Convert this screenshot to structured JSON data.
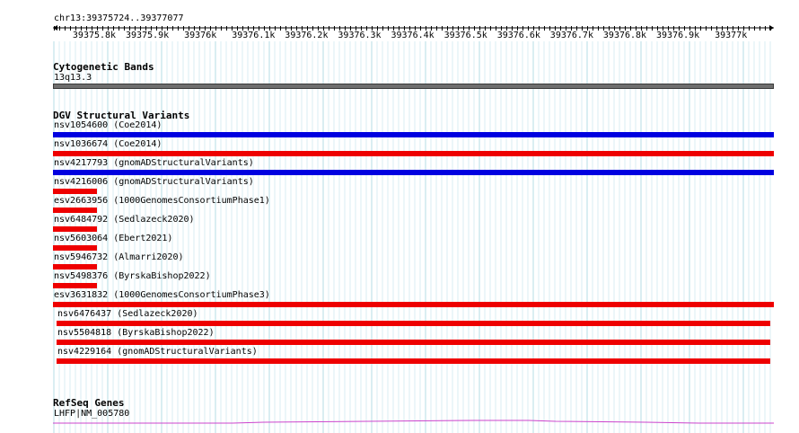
{
  "location": "chr13:39375724..39377077",
  "ruler_ticks": [
    "39375.8k",
    "39375.9k",
    "39376k",
    "39376.1k",
    "39376.2k",
    "39376.3k",
    "39376.4k",
    "39376.5k",
    "39376.6k",
    "39376.7k",
    "39376.8k",
    "39376.9k",
    "39377k"
  ],
  "tracks": {
    "cytobands": {
      "title": "Cytogenetic Bands",
      "band_label": "13q13.3",
      "band_color": "#6e6e6e"
    },
    "dgv": {
      "title": "DGV Structural Variants",
      "colors": {
        "blue": "#0000e0",
        "red": "#ee0000"
      },
      "features": [
        {
          "id": "nsv1054600",
          "source": "(Coe2014)",
          "color": "blue",
          "span": "full"
        },
        {
          "id": "nsv1036674",
          "source": "(Coe2014)",
          "color": "red",
          "span": "full"
        },
        {
          "id": "nsv4217793",
          "source": "(gnomADStructuralVariants)",
          "color": "blue",
          "span": "full"
        },
        {
          "id": "nsv4216006",
          "source": "(gnomADStructuralVariants)",
          "color": "red",
          "span": "short"
        },
        {
          "id": "esv2663956",
          "source": "(1000GenomesConsortiumPhase1)",
          "color": "red",
          "span": "short"
        },
        {
          "id": "nsv6484792",
          "source": "(Sedlazeck2020)",
          "color": "red",
          "span": "short"
        },
        {
          "id": "nsv5603064",
          "source": "(Ebert2021)",
          "color": "red",
          "span": "short"
        },
        {
          "id": "nsv5946732",
          "source": "(Almarri2020)",
          "color": "red",
          "span": "short"
        },
        {
          "id": "nsv5498376",
          "source": "(ByrskaBishop2022)",
          "color": "red",
          "span": "short"
        },
        {
          "id": "esv3631832",
          "source": "(1000GenomesConsortiumPhase3)",
          "color": "red",
          "span": "full"
        },
        {
          "id": "nsv6476437",
          "source": "(Sedlazeck2020)",
          "color": "red",
          "span": "inset"
        },
        {
          "id": "nsv5504818",
          "source": "(ByrskaBishop2022)",
          "color": "red",
          "span": "inset"
        },
        {
          "id": "nsv4229164",
          "source": "(gnomADStructuralVariants)",
          "color": "red",
          "span": "inset"
        }
      ]
    },
    "refseq": {
      "title": "RefSeq Genes",
      "gene_label": "LHFP|NM_005780",
      "gene_color": "#cc44cc"
    }
  }
}
